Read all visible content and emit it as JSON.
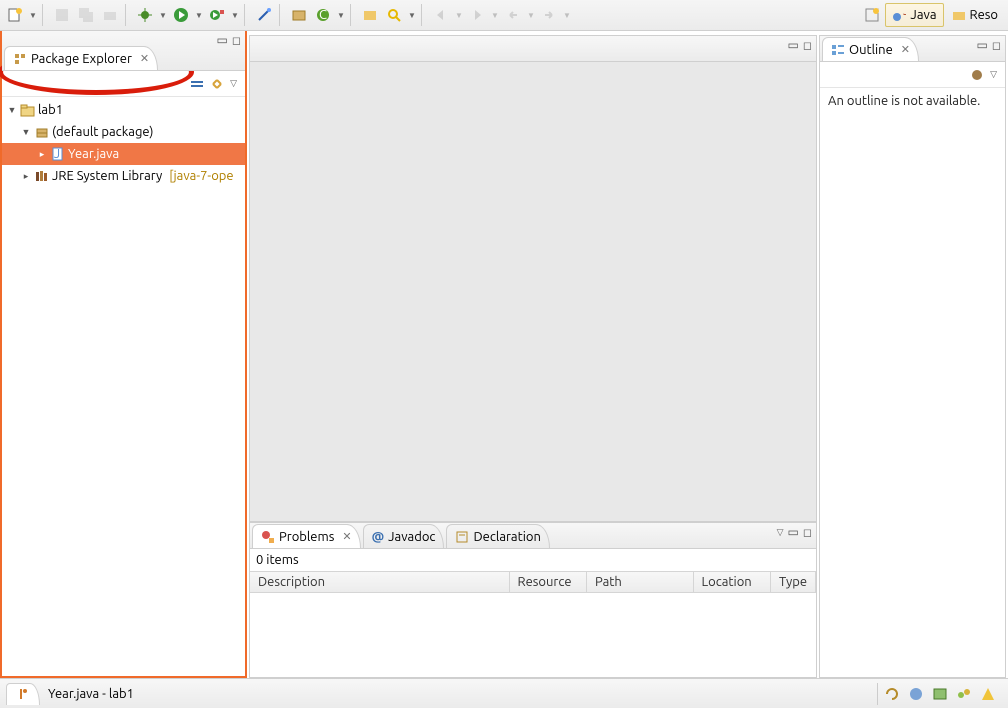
{
  "toolbar": {
    "persp_java": "Java",
    "persp_resource": "Reso"
  },
  "package_explorer": {
    "title": "Package Explorer",
    "tree": {
      "project": "lab1",
      "default_package": "(default package)",
      "file": "Year.java",
      "jre_label": "JRE System Library",
      "jre_suffix": "[java-7-ope"
    }
  },
  "outline": {
    "title": "Outline",
    "message": "An outline is not available."
  },
  "problems": {
    "tab_problems": "Problems",
    "tab_javadoc": "Javadoc",
    "tab_declaration": "Declaration",
    "items_count": "0 items",
    "columns": {
      "description": "Description",
      "resource": "Resource",
      "path": "Path",
      "location": "Location",
      "type": "Type"
    }
  },
  "status": {
    "file": "Year.java - lab1"
  }
}
